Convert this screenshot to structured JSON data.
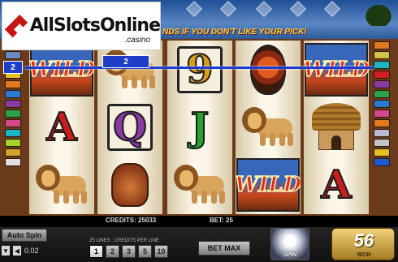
{
  "logo": {
    "main": "AllSlotsOnline",
    "sub": ".casino"
  },
  "marquee": "NDS IF YOU DON'T LIKE YOUR PICK!",
  "reels": [
    [
      "WILD",
      "A",
      "lion"
    ],
    [
      "lion",
      "Q",
      "vase"
    ],
    [
      "9",
      "J",
      "lion"
    ],
    [
      "mask",
      "lion",
      "WILD"
    ],
    [
      "WILD",
      "hut",
      "A"
    ]
  ],
  "payline": {
    "left_label": "2",
    "mid_label": "2"
  },
  "info": {
    "credits_label": "CREDITS: 25033",
    "bet_label": "BET: 25"
  },
  "controls": {
    "autospin": "Auto Spin",
    "coin_value": "0.02",
    "lines_caption": "25 LINES : CREDITS PER LINE",
    "bet_options": [
      "1",
      "2",
      "3",
      "5",
      "10"
    ],
    "bet_selected": "1",
    "betmax": "BET MAX",
    "spin": "SPIN"
  },
  "won": {
    "value": "56",
    "label": "WON"
  },
  "colors": {
    "left_bars": [
      "#b8b8d0",
      "#6a8ac0",
      "#d22020",
      "#e4c020",
      "#e4781e",
      "#2a7ad2",
      "#8a3aa3",
      "#2aa34a",
      "#d24a8a",
      "#1ab4c4",
      "#a3d22a",
      "#d2a32a",
      "#e0e0e0"
    ],
    "right_bars": [
      "#e07a1e",
      "#d2c24a",
      "#1ab4c4",
      "#d22020",
      "#8a3aa3",
      "#2aa34a",
      "#2a7ad2",
      "#d24a8a",
      "#e4781e",
      "#b8b8d0",
      "#c4c4c4",
      "#e4c020",
      "#1e5ad2"
    ]
  }
}
